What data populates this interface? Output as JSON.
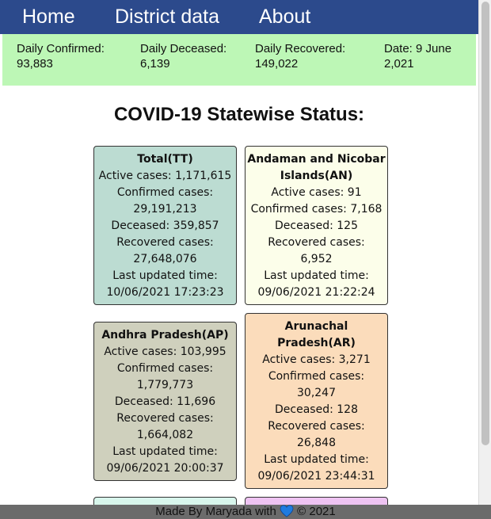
{
  "nav": {
    "home": "Home",
    "district": "District data",
    "about": "About"
  },
  "summary": {
    "confirmed_label": "Daily Confirmed:",
    "confirmed_value": "93,883",
    "deceased_label": "Daily Deceased:",
    "deceased_value": "6,139",
    "recovered_label": "Daily Recovered:",
    "recovered_value": "149,022",
    "date_line1": "Date: 9 June",
    "date_line2": "2,021"
  },
  "title": "COVID-19 Statewise Status:",
  "cards": [
    {
      "name": "Total(TT)",
      "active": "Active cases: 1,171,615",
      "confirmed_label": "Confirmed cases:",
      "confirmed_value": "29,191,213",
      "deceased": "Deceased: 359,857",
      "recovered_label": "Recovered cases:",
      "recovered_value": "27,648,076",
      "updated_label": "Last updated time:",
      "updated_value": "10/06/2021 17:23:23",
      "color": "#bcdcd2"
    },
    {
      "name": "Andaman and Nicobar Islands(AN)",
      "active": "Active cases: 91",
      "confirmed": "Confirmed cases: 7,168",
      "deceased": "Deceased: 125",
      "recovered_label": "Recovered cases:",
      "recovered_value": "6,952",
      "updated_label": "Last updated time:",
      "updated_value": "09/06/2021 21:22:24",
      "color": "#fcfeea"
    },
    {
      "name": "Andhra Pradesh(AP)",
      "active": "Active cases: 103,995",
      "confirmed_label": "Confirmed cases:",
      "confirmed_value": "1,779,773",
      "deceased": "Deceased: 11,696",
      "recovered_label": "Recovered cases:",
      "recovered_value": "1,664,082",
      "updated_label": "Last updated time:",
      "updated_value": "09/06/2021 20:00:37",
      "color": "#cfd0bd"
    },
    {
      "name": "Arunachal Pradesh(AR)",
      "active": "Active cases: 3,271",
      "confirmed_label": "Confirmed cases:",
      "confirmed_value": "30,247",
      "deceased": "Deceased: 128",
      "recovered_label": "Recovered cases:",
      "recovered_value": "26,848",
      "updated_label": "Last updated time:",
      "updated_value": "09/06/2021 23:44:31",
      "color": "#fbdcbb"
    }
  ],
  "partial_cards": {
    "left_color": "#d8f6ec",
    "right_color": "#eec3f2"
  },
  "footer": {
    "text_before": "Made By Maryada with",
    "heart_icon": "blue-heart-icon",
    "heart_color": "#1e7be0",
    "text_after": "© 2021"
  }
}
